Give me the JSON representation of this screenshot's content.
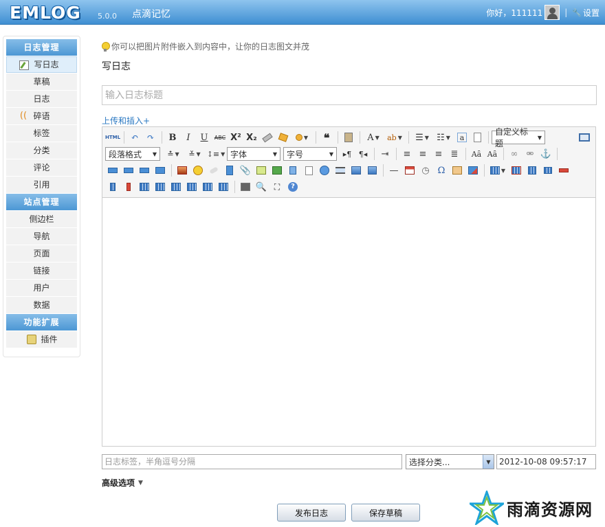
{
  "header": {
    "logo": "EMLOG",
    "version": "5.0.0",
    "site_name": "点滴记忆",
    "greeting": "你好，111111",
    "separator": "|",
    "settings_label": "设置"
  },
  "sidebar": {
    "sections": [
      {
        "title": "日志管理",
        "items": [
          "写日志",
          "草稿",
          "日志",
          "碎语",
          "标签",
          "分类",
          "评论",
          "引用"
        ]
      },
      {
        "title": "站点管理",
        "items": [
          "侧边栏",
          "导航",
          "页面",
          "链接",
          "用户",
          "数据"
        ]
      },
      {
        "title": "功能扩展",
        "items": [
          "插件"
        ]
      }
    ],
    "active_item": "写日志"
  },
  "main": {
    "tip": "你可以把图片附件嵌入到内容中，让你的日志图文并茂",
    "page_title": "写日志",
    "title_placeholder": "输入日志标题",
    "upload_link": "上传和插入+"
  },
  "editor": {
    "toolbar": {
      "row1": [
        "HTML",
        "撤销",
        "重做",
        "B",
        "I",
        "U",
        "ABC",
        "X²",
        "X₂",
        "清除格式",
        "格式刷",
        "自动排版",
        "引用",
        "粘贴为纯文本",
        "A",
        "ab",
        "有序列表",
        "无序列表",
        "a",
        "页面"
      ],
      "heading_select": "自定义标题",
      "paragraph_select": "段落格式",
      "font_select": "字体",
      "size_select": "字号"
    }
  },
  "footer": {
    "tag_placeholder": "日志标签，半角逗号分隔",
    "category_select": "选择分类...",
    "date_value": "2012-10-08 09:57:17",
    "advanced_label": "高级选项",
    "publish_button": "发布日志",
    "draft_button": "保存草稿"
  },
  "watermark": {
    "text": "雨滴资源网"
  },
  "colors": {
    "header_top": "#8ec4ee",
    "header_bottom": "#3f8fd2",
    "section_title": "#4c97d4",
    "link": "#2a78c2"
  }
}
